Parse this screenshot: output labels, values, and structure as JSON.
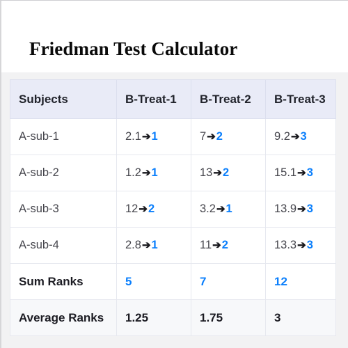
{
  "header": {
    "title": "Friedman Test Calculator"
  },
  "table": {
    "columns": [
      "Subjects",
      "B-Treat-1",
      "B-Treat-2",
      "B-Treat-3"
    ],
    "arrow_glyph": "➔",
    "accent_color": "#0b7ffc",
    "header_bg": "#e9ebf7",
    "rows": [
      {
        "label": "A-sub-1",
        "cells": [
          {
            "value": "2.1",
            "rank": "1"
          },
          {
            "value": "7",
            "rank": "2"
          },
          {
            "value": "9.2",
            "rank": "3"
          }
        ]
      },
      {
        "label": "A-sub-2",
        "cells": [
          {
            "value": "1.2",
            "rank": "1"
          },
          {
            "value": "13",
            "rank": "2"
          },
          {
            "value": "15.1",
            "rank": "3"
          }
        ]
      },
      {
        "label": "A-sub-3",
        "cells": [
          {
            "value": "12",
            "rank": "2"
          },
          {
            "value": "3.2",
            "rank": "1"
          },
          {
            "value": "13.9",
            "rank": "3"
          }
        ]
      },
      {
        "label": "A-sub-4",
        "cells": [
          {
            "value": "2.8",
            "rank": "1"
          },
          {
            "value": "11",
            "rank": "2"
          },
          {
            "value": "13.3",
            "rank": "3"
          }
        ]
      }
    ],
    "sum_ranks": {
      "label": "Sum Ranks",
      "values": [
        "5",
        "7",
        "12"
      ]
    },
    "average_ranks": {
      "label": "Average Ranks",
      "values": [
        "1.25",
        "1.75",
        "3"
      ]
    }
  }
}
